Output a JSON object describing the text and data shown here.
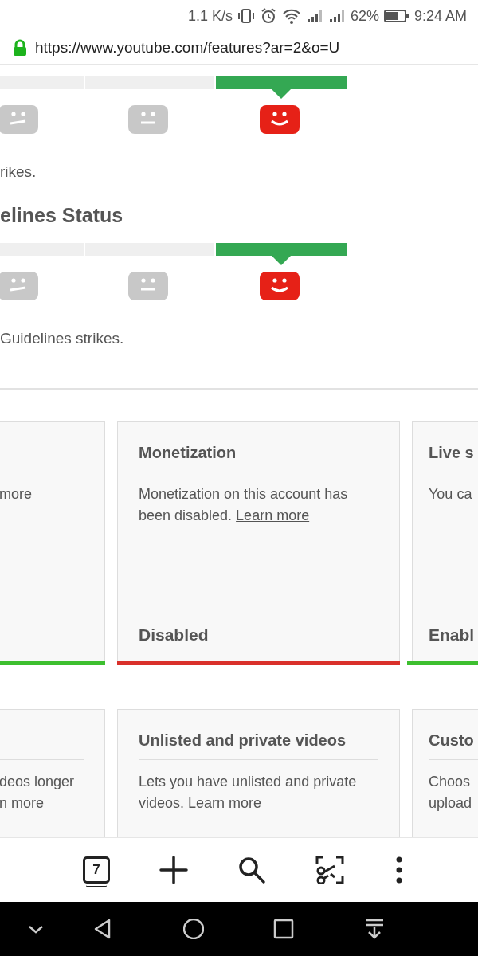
{
  "status_bar": {
    "speed": "1.1 K/s",
    "battery": "62%",
    "time": "9:24 AM"
  },
  "address_bar": {
    "url": "https://www.youtube.com/features?ar=2&o=U",
    "secure": true
  },
  "strike_sections": [
    {
      "segments": [
        {
          "kind": "sad",
          "selected": false
        },
        {
          "kind": "neutral",
          "selected": false
        },
        {
          "kind": "happy",
          "selected": true
        }
      ],
      "caption": "rikes."
    },
    {
      "heading": "elines Status",
      "segments": [
        {
          "kind": "sad",
          "selected": false
        },
        {
          "kind": "neutral",
          "selected": false
        },
        {
          "kind": "happy",
          "selected": true
        }
      ],
      "caption": " Guidelines strikes."
    }
  ],
  "card_rows": [
    {
      "cards": [
        {
          "link": "more",
          "color": "#3dbf2f"
        },
        {
          "title": "Monetization",
          "text": "Monetization on this account has been disabled.",
          "link": "Learn more",
          "status": "Disabled",
          "color": "#d9302a"
        },
        {
          "title": "Live s",
          "text": "You ca",
          "status": "Enabl",
          "color": "#3dbf2f"
        }
      ]
    },
    {
      "cards": [
        {
          "text": "deos longer",
          "link": "n more"
        },
        {
          "title": "Unlisted and private videos",
          "text": "Lets you have unlisted and private videos.",
          "link": "Learn more"
        },
        {
          "title": "Custo",
          "text": "Choos upload"
        }
      ]
    }
  ],
  "toolbar": {
    "tab_count": "7"
  }
}
